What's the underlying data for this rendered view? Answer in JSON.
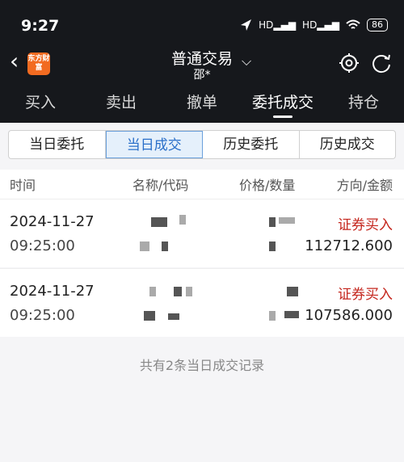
{
  "status_bar": {
    "time": "9:27",
    "battery": "86"
  },
  "header": {
    "logo_text": "东方财富",
    "title": "普通交易",
    "account": "邵*"
  },
  "nav_tabs": [
    "买入",
    "卖出",
    "撤单",
    "委托成交",
    "持仓"
  ],
  "segments": [
    "当日委托",
    "当日成交",
    "历史委托",
    "历史成交"
  ],
  "columns": [
    "时间",
    "名称/代码",
    "价格/数量",
    "方向/金额"
  ],
  "rows": [
    {
      "date": "2024-11-27",
      "time": "09:25:00",
      "direction": "证券买入",
      "amount": "112712.600"
    },
    {
      "date": "2024-11-27",
      "time": "09:25:00",
      "direction": "证券买入",
      "amount": "107586.000"
    }
  ],
  "footer_text": "共有2条当日成交记录"
}
